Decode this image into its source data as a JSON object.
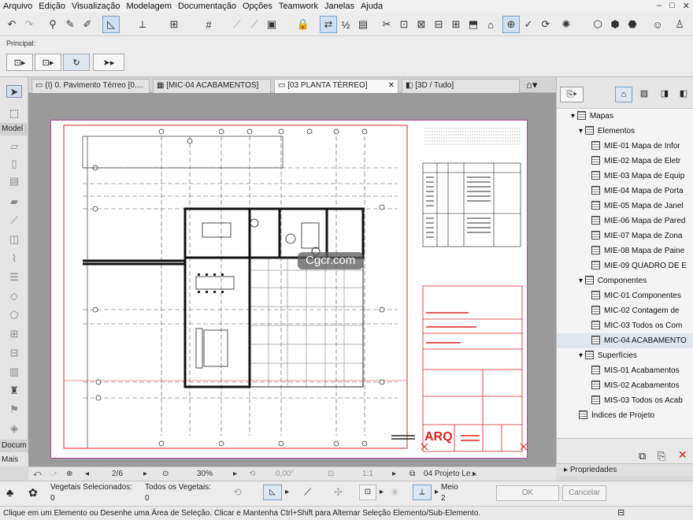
{
  "menu": [
    "Arquivo",
    "Edição",
    "Visualização",
    "Modelagem",
    "Documentação",
    "Opções",
    "Teamwork",
    "Janelas",
    "Ajuda"
  ],
  "window_controls": [
    "–",
    "□",
    "✕"
  ],
  "infobox": {
    "label": "Principal:"
  },
  "toolbox": {
    "section_model": "Model",
    "section_doc": "Docum",
    "section_more": "Mais"
  },
  "tabs": [
    {
      "label": "(I) 0. Pavimento Térreo [0....",
      "icon": "floorplan-icon"
    },
    {
      "label": "[MIC-04 ACABAMENTOS]",
      "icon": "schedule-icon"
    },
    {
      "label": "[03 PLANTA TÉRREO]",
      "icon": "layout-icon",
      "active": true
    },
    {
      "label": "[3D / Tudo]",
      "icon": "3d-icon"
    }
  ],
  "navigator": {
    "root": "Mapas",
    "groups": [
      {
        "label": "Elementos",
        "items": [
          "MIE-01 Mapa de Infor",
          "MIE-02 Mapa de Eletr",
          "MIE-03 Mapa de Equip",
          "MIE-04 Mapa de Porta",
          "MIE-05 Mapa de Janel",
          "MIE-06 Mapa de Pared",
          "MIE-07 Mapa de Zona",
          "MIE-08 Mapa de Paine",
          "MIE-09 QUADRO DE E"
        ]
      },
      {
        "label": "Componentes",
        "items": [
          "MIC-01 Componentes",
          "MIC-02 Contagem de",
          "MIC-03 Todos os Com",
          "MIC-04 ACABAMENTO"
        ]
      },
      {
        "label": "Superfícies",
        "items": [
          "MIS-01 Acabamentos",
          "MIS-02 Acabamentos",
          "MIS-03 Todos os Acab"
        ]
      },
      {
        "label": "Índices de Projeto",
        "items": []
      }
    ],
    "selected": "MIC-04 ACABAMENTO",
    "properties_label": "Propriedades"
  },
  "navrow": {
    "page": "2/6",
    "zoom": "30%",
    "angle": "0,00°",
    "scale": "1:1",
    "layout": "04 Projeto Le..."
  },
  "bottombar": {
    "vegetais_sel": "Vegetais Selecionados:",
    "vegetais_sel_count": "0",
    "todos_vegetais": "Todos os Vegetais:",
    "todos_count": "0",
    "meio_label": "Meio",
    "meio_value": "2",
    "ok": "OK",
    "cancel": "Cancelar"
  },
  "status": "Clique em um Elemento ou Desenhe uma Área de Seleção. Clicar e Mantenha Ctrl+Shift para Alternar Seleção Elemento/Sub-Elemento.",
  "watermark": "Cgcr.com",
  "titleblock_label": "ARQ"
}
